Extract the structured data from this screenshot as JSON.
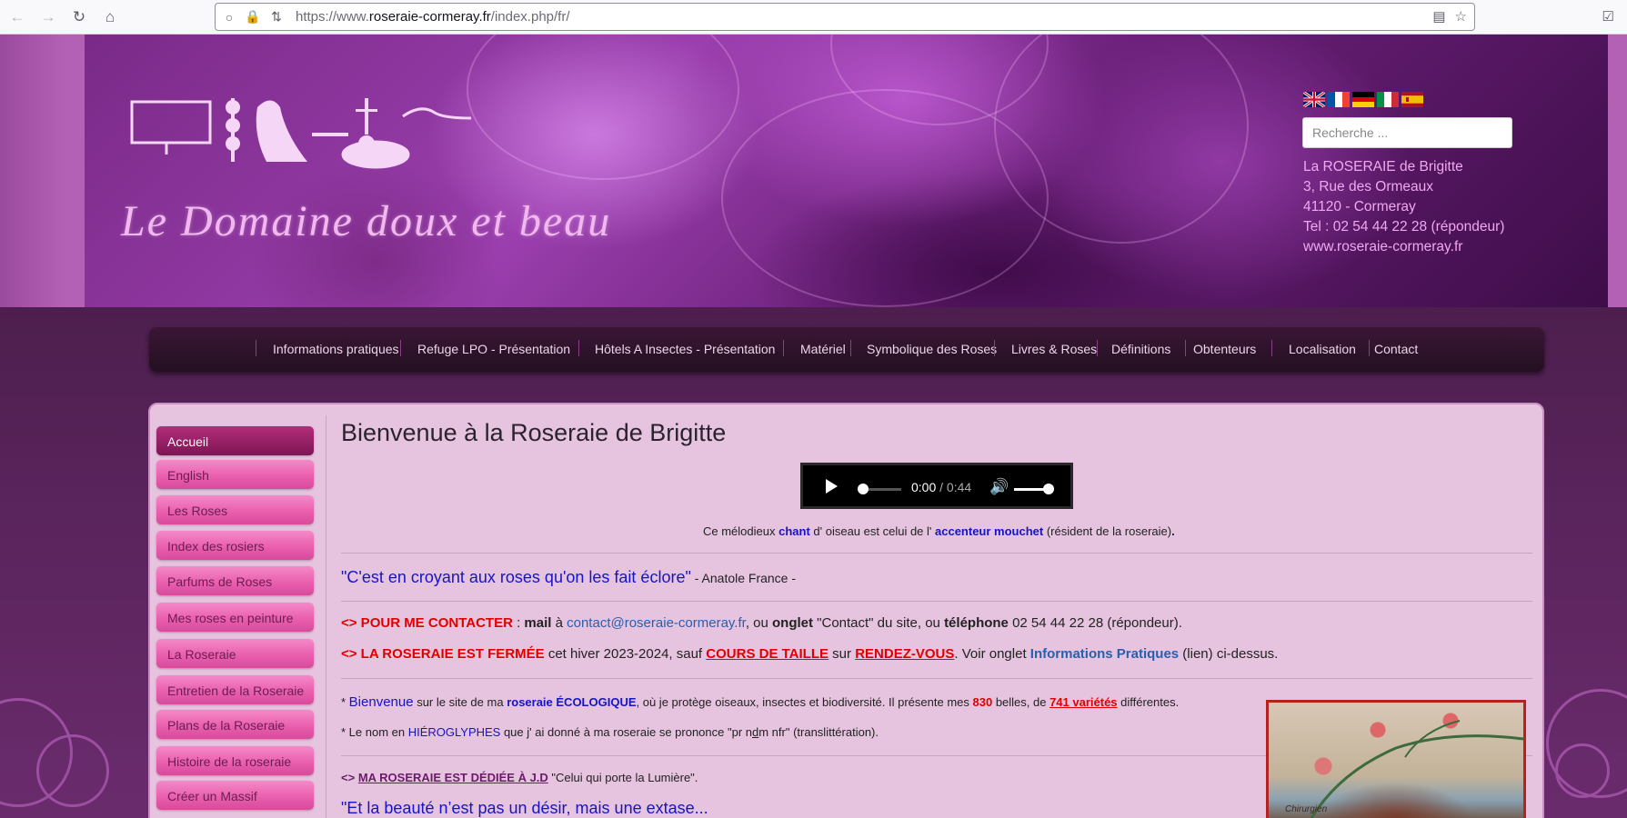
{
  "browser": {
    "url_prefix": "https://www.",
    "url_domain": "roseraie-cormeray.fr",
    "url_path": "/index.php/fr/"
  },
  "header": {
    "logo_text": "Le Domaine doux et beau",
    "search_placeholder": "Recherche ...",
    "flags": [
      "English",
      "Français",
      "Deutsch",
      "Italiano",
      "Español"
    ],
    "address": {
      "line1": "La ROSERAIE de Brigitte",
      "line2": "3, Rue des Ormeaux",
      "line3": "41120 - Cormeray",
      "line4": "Tel : 02 54 44 22 28 (répondeur)",
      "line5": "www.roseraie-cormeray.fr"
    }
  },
  "menu": {
    "items": [
      "Informations pratiques",
      "Refuge LPO - Présentation",
      "Hôtels A Insectes - Présentation",
      "Matériel",
      "Symbolique des Roses",
      "Livres & Roses",
      "Définitions",
      "Obtenteurs",
      "Localisation",
      "Contact"
    ]
  },
  "sidebar": {
    "items": [
      "Accueil",
      "English",
      "Les Roses",
      "Index des rosiers",
      "Parfums de Roses",
      "Mes roses en peinture",
      "La Roseraie",
      "Entretien de la Roseraie",
      "Plans de la Roseraie",
      "Histoire de la roseraie",
      "Créer un Massif"
    ]
  },
  "main": {
    "title": "Bienvenue à la Roseraie de Brigitte",
    "player": {
      "current": "0:00",
      "separator": " / ",
      "duration": "0:44"
    },
    "bird_line": {
      "a": "Ce mélodieux ",
      "b": "chant",
      "c": " d' oiseau est celui de l' ",
      "d": "accenteur mouchet",
      "e": " (résident de la roseraie)",
      "f": "."
    },
    "quote1": {
      "text": "\"C'est en croyant aux roses qu'on les fait éclore\"",
      "author": " - Anatole France -"
    },
    "contact": {
      "marker": "<> POUR ME CONTACTER",
      "a": " : ",
      "mail": "mail",
      "b": " à ",
      "email": "contact@roseraie-cormeray.fr",
      "c": ", ou ",
      "onglet": "onglet",
      "d": " \"Contact\" du site, ou ",
      "tel": "téléphone",
      "e": " 02 54 44 22 28 (répondeur)."
    },
    "closed": {
      "marker": "<> LA ROSERAIE EST FERMÉE",
      "a": " cet hiver 2023-2024, sauf ",
      "cours": "COURS DE TAILLE",
      "b": " sur ",
      "rdv": "RENDEZ-VOUS",
      "c": ". Voir onglet ",
      "info": "Informations Pratiques",
      "d": " (lien) ci-dessus."
    },
    "welcome": {
      "a": "* ",
      "b": "Bienvenue",
      "c": " sur le site de ma ",
      "d": "roseraie ÉCOLOGIQUE",
      "e": ", où je protège oiseaux, insectes et biodiversité. Il présente mes ",
      "f": "830",
      "g": " belles, de ",
      "h": "741 variétés",
      "i": " différentes."
    },
    "name_line": {
      "a": "* Le nom en ",
      "b": "HIÉROGLYPHES",
      "c": " que j' ai donné à ma roseraie se prononce \"pr n",
      "d": "d",
      "e": "m nfr\" (translittération)."
    },
    "dedication": {
      "marker": "<>",
      "a": " ",
      "b": "MA ROSERAIE EST DÉDIÉE À J.D",
      "c": " \"Celui qui porte la Lumière\"."
    },
    "quote2": "\"Et la beauté n’est pas un désir, mais une extase...",
    "painting_caption": "Chirurgien"
  },
  "colors": {
    "accent": "#b361b5",
    "menu_bg": "#2b1228",
    "panel_bg": "#e6c3de",
    "sidebar_item": "#ea5fae",
    "sidebar_active": "#7c1553",
    "alert_red": "#e00000",
    "link_blue": "#1515c8"
  }
}
